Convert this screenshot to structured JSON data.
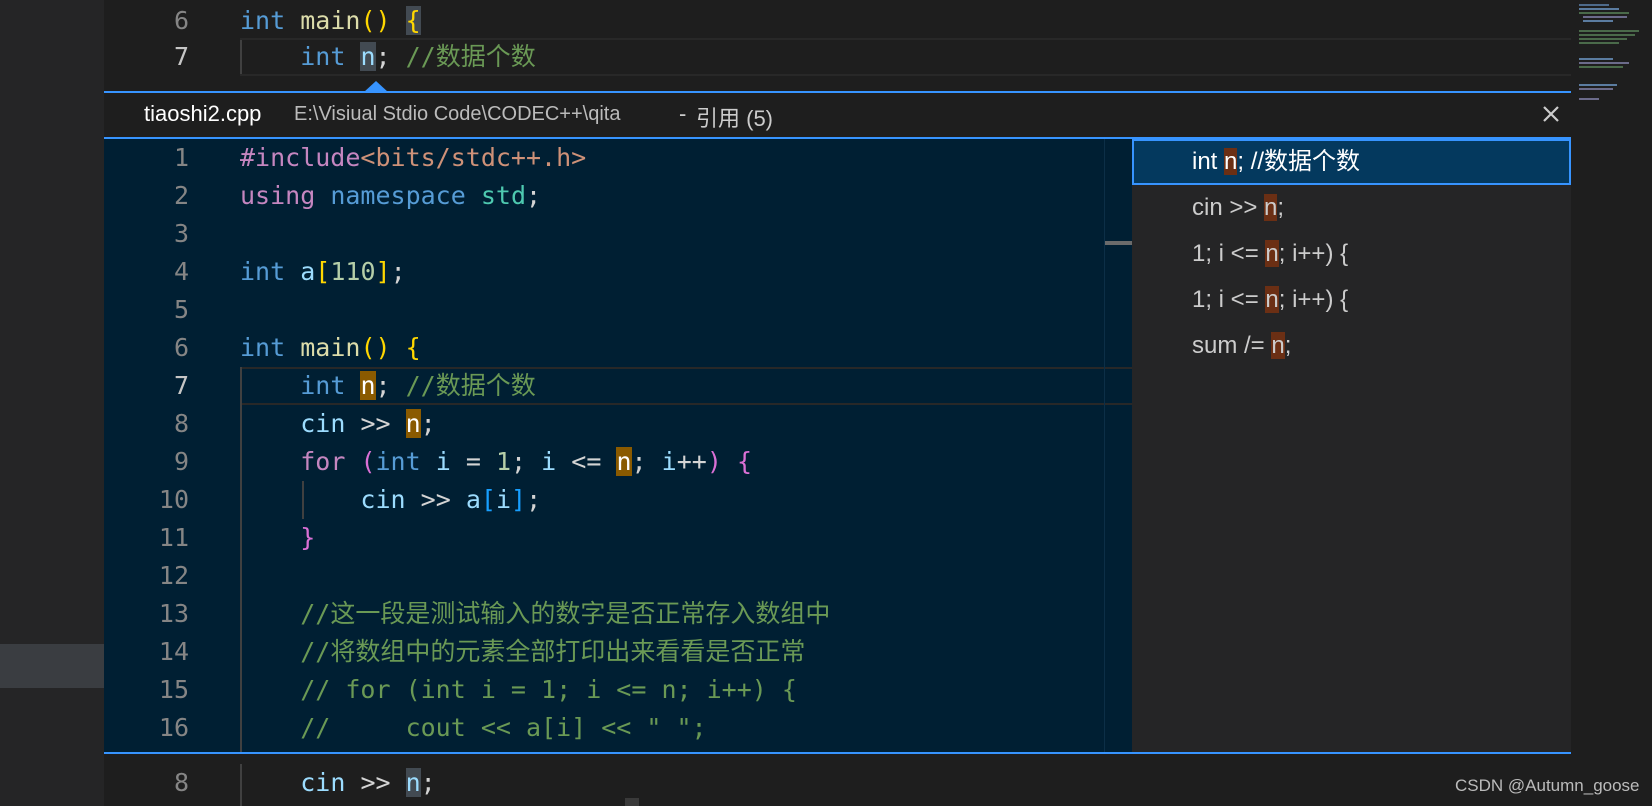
{
  "peek": {
    "file_name": "tiaoshi2.cpp",
    "file_path": "E:\\Visiual Stdio Code\\CODEC++\\qita",
    "separator": "-",
    "ref_title": "引用 (5)",
    "close_icon": "close-icon"
  },
  "editor_top": {
    "line6_num": "6",
    "line7_num": "7",
    "line6": {
      "kw": "int",
      "fn": "main",
      "parens": "()",
      "brace": "{"
    },
    "line7": {
      "kw": "int",
      "var": "n",
      "semi": ";",
      "comment": "//数据个数"
    }
  },
  "peek_code": {
    "line_numbers": [
      "1",
      "2",
      "3",
      "4",
      "5",
      "6",
      "7",
      "8",
      "9",
      "10",
      "11",
      "12",
      "13",
      "14",
      "15",
      "16"
    ],
    "l1": {
      "inc": "#include",
      "hdr": "<bits/stdc++.h>"
    },
    "l2": {
      "using": "using",
      "ns": "namespace",
      "std": "std",
      "semi": ";"
    },
    "l4": {
      "kw": "int",
      "var": "a",
      "lb": "[",
      "num": "110",
      "rb": "]",
      "semi": ";"
    },
    "l6": {
      "kw": "int",
      "fn": "main",
      "parens": "()",
      "brace": "{"
    },
    "l7": {
      "kw": "int",
      "var": "n",
      "semi": ";",
      "comment": "//数据个数"
    },
    "l8": {
      "cin": "cin",
      "op": ">>",
      "var": "n",
      "semi": ";"
    },
    "l9": {
      "for": "for",
      "lp": "(",
      "kw": "int",
      "i1": "i",
      "eq": "=",
      "one": "1",
      "semi1": ";",
      "i2": "i",
      "le": "<=",
      "n": "n",
      "semi2": ";",
      "i3": "i",
      "pp": "++",
      "rp": ")",
      "brace": "{"
    },
    "l10": {
      "cin": "cin",
      "op": ">>",
      "a": "a",
      "lb": "[",
      "i": "i",
      "rb": "]",
      "semi": ";"
    },
    "l11": {
      "brace": "}"
    },
    "l13": "//这一段是测试输入的数字是否正常存入数组中",
    "l14": "//将数组中的元素全部打印出来看看是否正常",
    "l15": "// for (int i = 1; i <= n; i++) {",
    "l16": "//     cout << a[i] << \" \";"
  },
  "references": [
    {
      "pre": "int ",
      "hit": "n",
      "post": "; //数据个数"
    },
    {
      "pre": "cin >> ",
      "hit": "n",
      "post": ";"
    },
    {
      "pre": "1; i <= ",
      "hit": "n",
      "post": "; i++) {"
    },
    {
      "pre": "1; i <= ",
      "hit": "n",
      "post": "; i++) {"
    },
    {
      "pre": "sum /= ",
      "hit": "n",
      "post": ";"
    }
  ],
  "editor_bottom": {
    "line8_num": "8",
    "line8": {
      "cin": "cin",
      "op": ">>",
      "var": "n",
      "semi": ";"
    }
  },
  "watermark": "CSDN @Autumn_goose",
  "colors": {
    "accent": "#3794ff",
    "peek_bg": "#001f33",
    "highlight": "#8a5a00"
  }
}
